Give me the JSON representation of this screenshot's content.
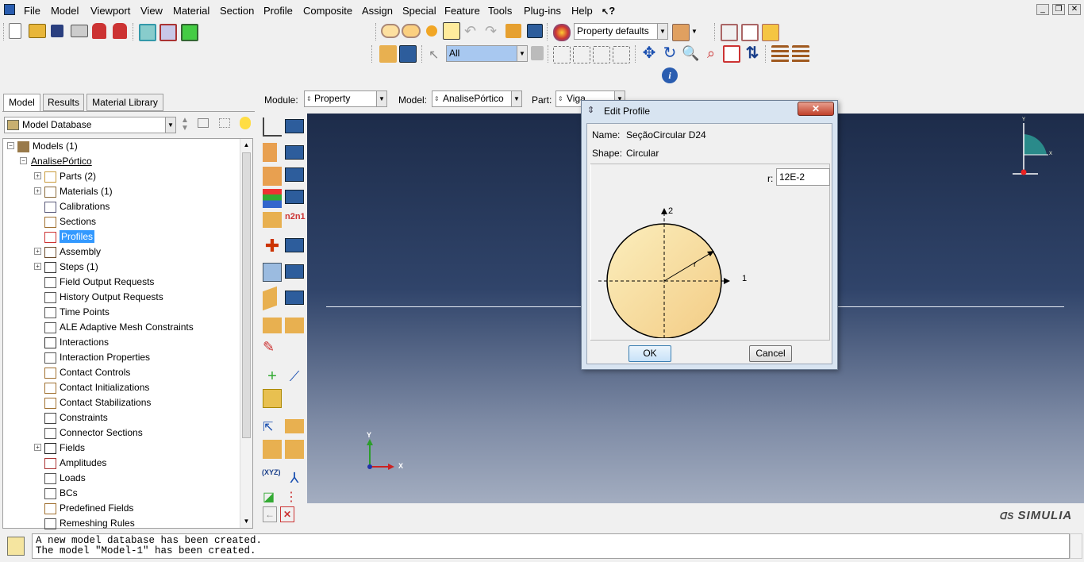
{
  "menubar": {
    "items": [
      "File",
      "Model",
      "Viewport",
      "View",
      "Material",
      "Section",
      "Profile",
      "Composite",
      "Assign",
      "Special",
      "Feature",
      "Tools",
      "Plug-ins",
      "Help"
    ],
    "help_glyph": "?"
  },
  "toolbar": {
    "render_style": "Property defaults",
    "selection_filter": "All"
  },
  "context": {
    "module_label": "Module:",
    "module_value": "Property",
    "model_label": "Model:",
    "model_value": "AnalisePórtico",
    "part_label": "Part:",
    "part_value": "Viga"
  },
  "tabs": [
    "Model",
    "Results",
    "Material Library"
  ],
  "database_selector": "Model Database",
  "tree": {
    "root": "Models (1)",
    "model": "AnalisePórtico",
    "items": [
      "Parts (2)",
      "Materials (1)",
      "Calibrations",
      "Sections",
      "Profiles",
      "Assembly",
      "Steps (1)",
      "Field Output Requests",
      "History Output Requests",
      "Time Points",
      "ALE Adaptive Mesh Constraints",
      "Interactions",
      "Interaction Properties",
      "Contact Controls",
      "Contact Initializations",
      "Contact Stabilizations",
      "Constraints",
      "Connector Sections",
      "Fields",
      "Amplitudes",
      "Loads",
      "BCs",
      "Predefined Fields",
      "Remeshing Rules"
    ],
    "selected": "Profiles"
  },
  "dialog": {
    "title": "Edit Profile",
    "name_label": "Name:",
    "name_value": "SeçãoCircular D24",
    "shape_label": "Shape:",
    "shape_value": "Circular",
    "r_label": "r:",
    "r_value": "12E-2",
    "axis1": "1",
    "axis2": "2",
    "radius_label": "r",
    "ok_label": "OK",
    "cancel_label": "Cancel"
  },
  "viewport": {
    "triad_x": "X",
    "triad_y": "Y",
    "mini_x": "X",
    "mini_y": "Y",
    "brand": "SIMULIA"
  },
  "messages": {
    "line1": "A new model database has been created.",
    "line2": "The model \"Model-1\" has been created."
  },
  "toolbox_labels": {
    "xyz": "(XYZ)"
  },
  "colors": {
    "selection": "#3399ff",
    "viewport_top": "#1d2c4a",
    "viewport_bottom": "#a3adc0",
    "profile_fill": "#f8e1a0"
  }
}
